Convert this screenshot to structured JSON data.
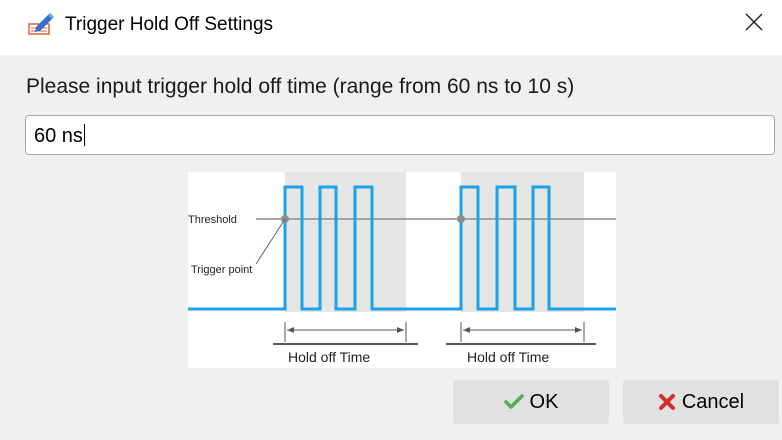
{
  "window": {
    "title": "Trigger Hold Off Settings",
    "title_icon": "edit-pencil-icon",
    "close_icon": "close-icon"
  },
  "form": {
    "prompt": "Please input trigger hold off time (range from 60 ns to 10 s)",
    "input_value": "60 ns"
  },
  "diagram": {
    "threshold_label": "Threshold",
    "trigger_point_label": "Trigger point",
    "hold_off_label_1": "Hold off Time",
    "hold_off_label_2": "Hold off Time",
    "colors": {
      "pulse": "#1aa3e8",
      "threshold_line": "#8c8c8c",
      "shading": "#e6e6e6"
    }
  },
  "buttons": {
    "ok_label": "OK",
    "ok_icon": "checkmark-icon",
    "cancel_label": "Cancel",
    "cancel_icon": "x-icon"
  },
  "colors": {
    "ok_check": "#4caf50",
    "cancel_x": "#d32f2f"
  }
}
